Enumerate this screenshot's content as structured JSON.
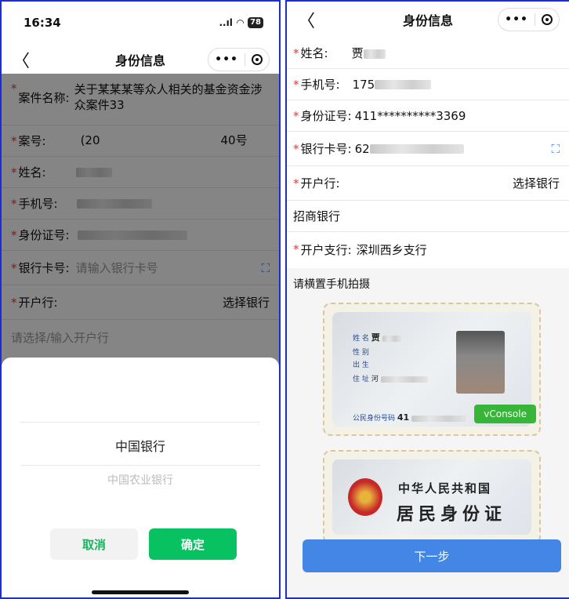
{
  "left": {
    "status": {
      "time": "16:34",
      "signal": "..ıl",
      "wifi": "⌔",
      "battery": "78"
    },
    "nav": {
      "title": "身份信息"
    },
    "fields": {
      "case_name_label": "案件名称:",
      "case_name_value": "关于某某某等众人相关的基金资金涉众案件33",
      "case_no_label": "案号:",
      "case_no_prefix": "(20",
      "case_no_suffix": "40号",
      "name_label": "姓名:",
      "phone_label": "手机号:",
      "id_label": "身份证号:",
      "card_label": "银行卡号:",
      "card_placeholder": "请输入银行卡号",
      "bank_label": "开户行:",
      "bank_select": "选择银行",
      "bank_input_placeholder": "请选择/输入开户行"
    },
    "picker": {
      "selected": "中国银行",
      "next": "中国农业银行",
      "cancel": "取消",
      "confirm": "确定"
    }
  },
  "right": {
    "nav": {
      "title": "身份信息"
    },
    "fields": {
      "name_label": "姓名:",
      "name_value": "贾",
      "phone_label": "手机号:",
      "phone_value": "175",
      "id_label": "身份证号:",
      "id_value": "411**********3369",
      "card_label": "银行卡号:",
      "card_value": "62",
      "bank_label": "开户行:",
      "bank_select": "选择银行",
      "bank_value": "招商银行",
      "branch_label": "开户支行:",
      "branch_value": "深圳西乡支行"
    },
    "photo_hint": "请横置手机拍摄",
    "id_front": {
      "name_field": "姓 名",
      "name_value": "贾",
      "gender_field": "性 别",
      "birth_field": "出 生",
      "address_field": "住 址",
      "address_value": "河",
      "id_field": "公民身份号码",
      "id_value": "41"
    },
    "id_back": {
      "title": "中华人民共和国",
      "subtitle": "居民身份证"
    },
    "vconsole": "vConsole",
    "next_button": "下一步"
  }
}
